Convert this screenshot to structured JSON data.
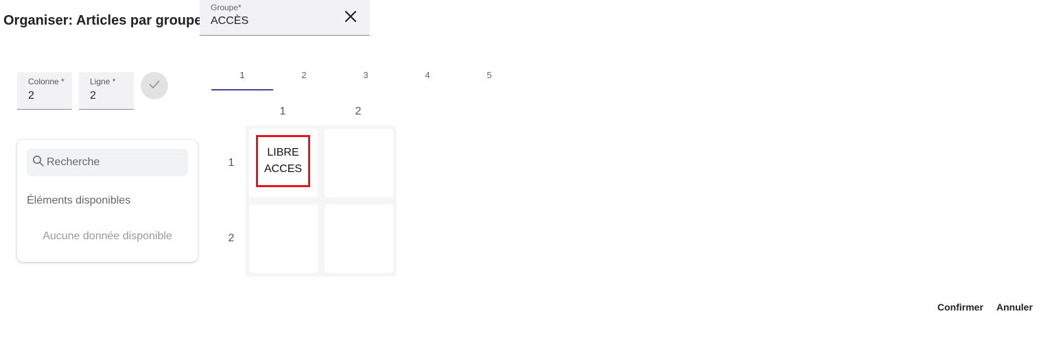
{
  "title": "Organiser: Articles par groupe:",
  "group_field": {
    "label": "Groupe*",
    "value": "ACCÈS"
  },
  "column_field": {
    "label": "Colonne *",
    "value": "2"
  },
  "row_field": {
    "label": "Ligne *",
    "value": "2"
  },
  "panel": {
    "search_placeholder": "Recherche",
    "available_title": "Éléments disponibles",
    "empty_text": "Aucune donnée disponible"
  },
  "tabs": [
    "1",
    "2",
    "3",
    "4",
    "5"
  ],
  "active_tab": "1",
  "grid": {
    "column_headers": [
      "1",
      "2"
    ],
    "row_headers": [
      "1",
      "2"
    ],
    "item": {
      "line1": "LIBRE",
      "line2": "ACCES"
    }
  },
  "actions": {
    "confirm": "Confirmer",
    "cancel": "Annuler"
  },
  "colors": {
    "accent": "#3c4a9a",
    "highlight": "#e3161f"
  },
  "icons": {
    "clear": "close-icon",
    "confirm": "check-icon",
    "search": "search-icon"
  }
}
